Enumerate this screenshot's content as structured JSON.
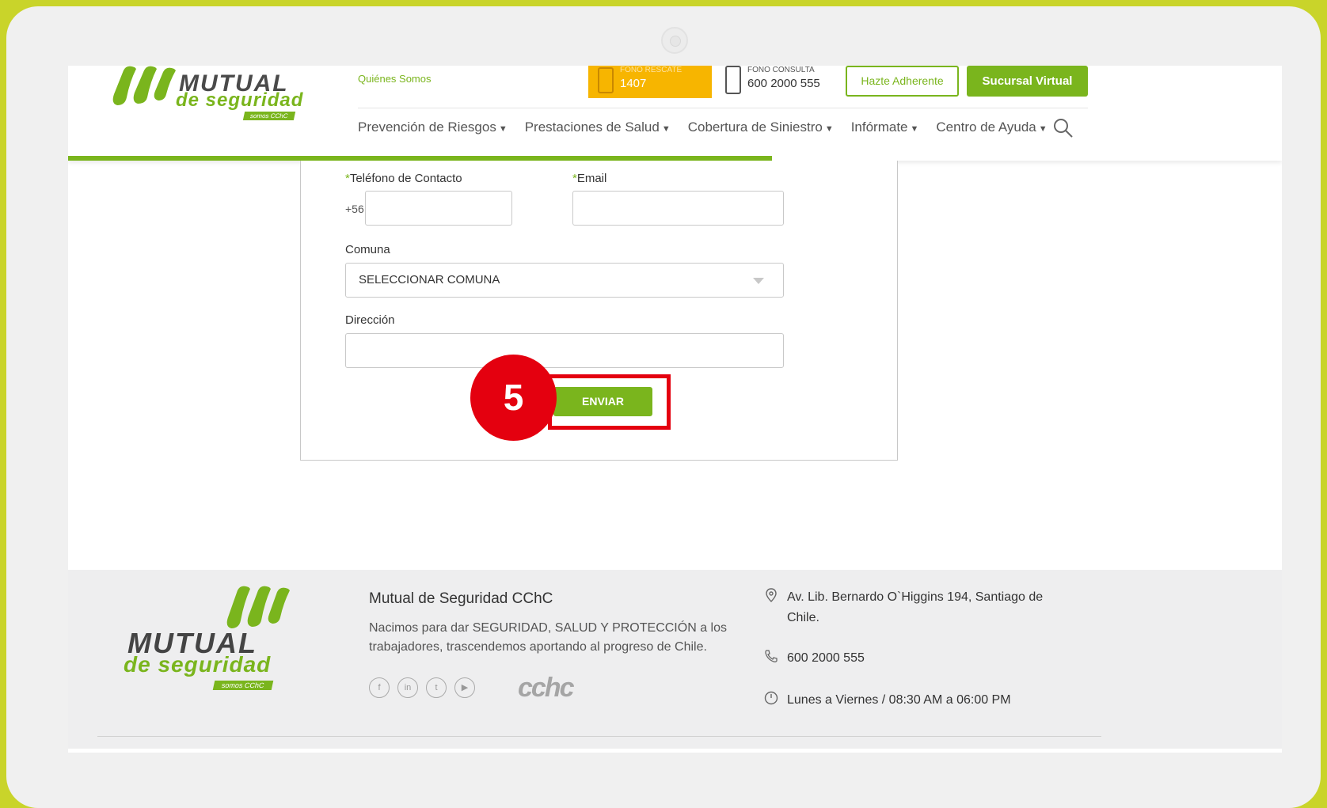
{
  "header": {
    "brand_line1": "MUTUAL",
    "brand_line2": "de seguridad",
    "brand_badge": "somos CChC",
    "quienes_somos": "Quiénes Somos",
    "fono_rescate_label": "FONO RESCATE",
    "fono_rescate_number": "1407",
    "fono_consulta_label": "FONO CONSULTA",
    "fono_consulta_number": "600 2000 555",
    "adherente_label": "Hazte Adherente",
    "sucursal_label": "Sucursal Virtual",
    "progress_fraction": 0.58,
    "nav": [
      {
        "label": "Prevención de Riesgos"
      },
      {
        "label": "Prestaciones de Salud"
      },
      {
        "label": "Cobertura de Siniestro"
      },
      {
        "label": "Infórmate"
      },
      {
        "label": "Centro de Ayuda"
      }
    ]
  },
  "form": {
    "phone_label": "Teléfono de Contacto",
    "phone_prefix": "+56",
    "phone_value": "",
    "email_label": "Email",
    "email_value": "",
    "comuna_label": "Comuna",
    "comuna_selected": "SELECCIONAR COMUNA",
    "direccion_label": "Dirección",
    "direccion_value": "",
    "submit_label": "ENVIAR",
    "required_mark": "*"
  },
  "annotation": {
    "step_number": "5",
    "highlight_color": "#e4000f"
  },
  "footer": {
    "brand_line1": "MUTUAL",
    "brand_line2": "de seguridad",
    "brand_badge": "somos CChC",
    "title": "Mutual de Seguridad CChC",
    "description": "Nacimos para dar SEGURIDAD, SALUD Y PROTECCIÓN a los trabajadores, trascendemos aportando al progreso de Chile.",
    "socials": [
      "facebook-icon",
      "linkedin-icon",
      "twitter-icon",
      "youtube-icon"
    ],
    "cchc_logo": "cchc",
    "address": "Av. Lib. Bernardo O`Higgins 194, Santiago de Chile.",
    "phone": "600 2000 555",
    "hours": "Lunes a Viernes / 08:30 AM a 06:00 PM"
  },
  "colors": {
    "brand_green": "#7ab51d",
    "rescate_yellow": "#f7b500",
    "frame_lime": "#c9d42a",
    "annotation_red": "#e4000f"
  }
}
